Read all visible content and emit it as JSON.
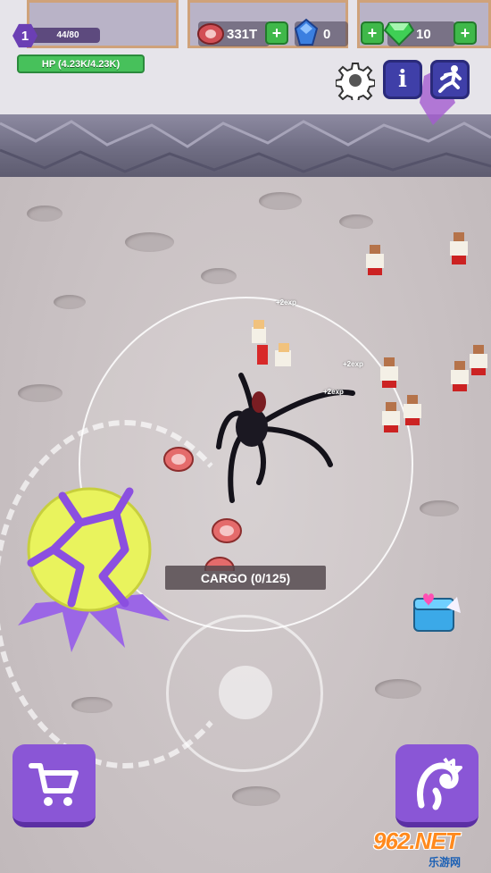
{
  "player": {
    "level": "1",
    "xp": "44/80",
    "hp": "HP (4.23K/4.23K)"
  },
  "resources": {
    "meat": "331T",
    "blue_gem": "0",
    "green_gem": "10"
  },
  "icons": {
    "meat": "meat-icon",
    "blue_gem": "blue-gem-icon",
    "green_gem": "green-gem-icon",
    "settings": "gear-icon",
    "info": "info-icon",
    "move": "running-man-icon",
    "shop": "cart-icon",
    "evolve": "monster-head-icon",
    "chest": "heart-chest-icon"
  },
  "buttons": {
    "plus": "+",
    "info": "i"
  },
  "cargo": "CARGO (0/125)",
  "exp_popups": [
    "+2exp",
    "+2exp",
    "+2exp"
  ],
  "watermark": {
    "main": "962.NET",
    "sub": "乐游网"
  },
  "colors": {
    "hud_purple": "#6b3fb4",
    "hp_green": "#47c15b",
    "plus_green": "#3fb84a",
    "button_purple": "#8a56d6",
    "info_blue": "#3f3fa8",
    "orb_yellow": "#e6f05a",
    "crack_purple": "#8b4fe0"
  }
}
